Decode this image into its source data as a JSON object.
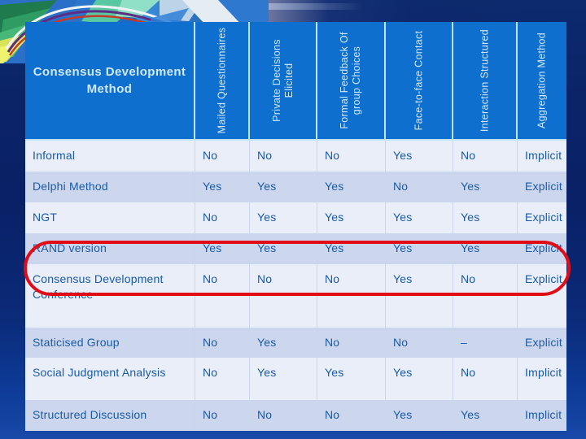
{
  "slide": {
    "background_color": "#0a2066",
    "accent_color": "#0f6fce",
    "highlight_color": "#e00d17"
  },
  "table": {
    "headers": [
      {
        "label": "Consensus Development Method",
        "orientation": "horizontal"
      },
      {
        "label": "Mailed Questionnaires",
        "orientation": "vertical"
      },
      {
        "label": "Private Decisions Elicited",
        "orientation": "vertical"
      },
      {
        "label": "Formal Feedback Of group Choices",
        "orientation": "vertical"
      },
      {
        "label": "Face-to-face Contact",
        "orientation": "vertical"
      },
      {
        "label": "Interaction Structured",
        "orientation": "vertical"
      },
      {
        "label": "Aggregation Method",
        "orientation": "vertical"
      }
    ],
    "rows": [
      {
        "method": "Informal",
        "mailed_questionnaires": "No",
        "private_decisions_elicited": "No",
        "formal_feedback": "No",
        "face_to_face_contact": "Yes",
        "interaction_structured": "No",
        "aggregation_method": "Implicit",
        "highlighted": false
      },
      {
        "method": "Delphi Method",
        "mailed_questionnaires": "Yes",
        "private_decisions_elicited": "Yes",
        "formal_feedback": "Yes",
        "face_to_face_contact": "No",
        "interaction_structured": "Yes",
        "aggregation_method": "Explicit",
        "highlighted": false
      },
      {
        "method": "NGT",
        "mailed_questionnaires": "No",
        "private_decisions_elicited": "Yes",
        "formal_feedback": "Yes",
        "face_to_face_contact": "Yes",
        "interaction_structured": "Yes",
        "aggregation_method": "Explicit",
        "highlighted": false
      },
      {
        "method": "RAND version",
        "mailed_questionnaires": "Yes",
        "private_decisions_elicited": "Yes",
        "formal_feedback": "Yes",
        "face_to_face_contact": "Yes",
        "interaction_structured": "Yes",
        "aggregation_method": "Explicit",
        "highlighted": false
      },
      {
        "method": "Consensus Development Conference",
        "mailed_questionnaires": "No",
        "private_decisions_elicited": "No",
        "formal_feedback": "No",
        "face_to_face_contact": "Yes",
        "interaction_structured": "No",
        "aggregation_method": "Explicit",
        "highlighted": true
      },
      {
        "method": "Staticised  Group",
        "mailed_questionnaires": "No",
        "private_decisions_elicited": "Yes",
        "formal_feedback": "No",
        "face_to_face_contact": "No",
        "interaction_structured": "–",
        "aggregation_method": "Explicit",
        "highlighted": false
      },
      {
        "method": "Social  Judgment Analysis",
        "mailed_questionnaires": "No",
        "private_decisions_elicited": "Yes",
        "formal_feedback": "Yes",
        "face_to_face_contact": "Yes",
        "interaction_structured": "No",
        "aggregation_method": "Implicit",
        "highlighted": false
      },
      {
        "method": "Structured Discussion",
        "mailed_questionnaires": "No",
        "private_decisions_elicited": "No",
        "formal_feedback": "No",
        "face_to_face_contact": "Yes",
        "interaction_structured": "Yes",
        "aggregation_method": "Implicit",
        "highlighted": false
      }
    ]
  }
}
